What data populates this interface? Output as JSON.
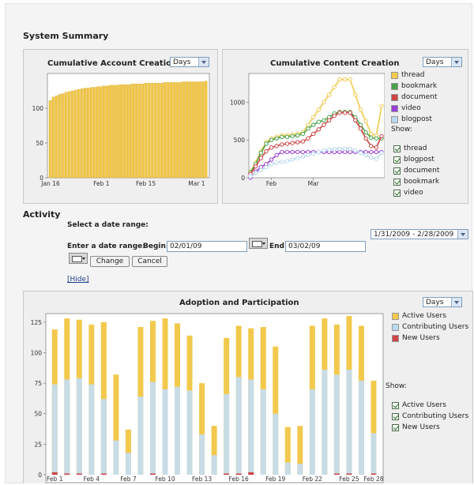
{
  "summary": {
    "title": "System Summary",
    "account_chart": {
      "title": "Cumulative Account Creation",
      "period_select": "Days"
    },
    "content_chart": {
      "title": "Cumulative Content Creation",
      "period_select": "Days",
      "show_label": "Show:"
    }
  },
  "activity": {
    "title": "Activity",
    "select_range_label": "Select a date range:",
    "range_dropdown": "1/31/2009 - 2/28/2009",
    "enter_range_label": "Enter a date range:",
    "begin_label": "Begin:",
    "begin_value": "02/01/09",
    "end_label": "End:",
    "end_value": "03/02/09",
    "change_button": "Change",
    "cancel_button": "Cancel",
    "hide_link": "[Hide]"
  },
  "adoption": {
    "title": "Adoption and Participation",
    "period_select": "Days",
    "show_label": "Show:"
  },
  "colors": {
    "yellow": "#f2c94c",
    "green": "#4aa24a",
    "red": "#cc4444",
    "purple": "#9b3fd8",
    "lightblue": "#b9d9f0"
  },
  "chart_data": [
    {
      "type": "bar",
      "title": "Cumulative Account Creation",
      "x_ticks": [
        "Jan 16",
        "Feb 1",
        "Feb 15",
        "Mar 1"
      ],
      "y_ticks": [
        0,
        50,
        100
      ],
      "ylim": [
        0,
        150
      ],
      "values": [
        111,
        116,
        118,
        120,
        121,
        123,
        124,
        125,
        126,
        127,
        128,
        129,
        129,
        130,
        130,
        131,
        131,
        132,
        132,
        133,
        133,
        133,
        134,
        134,
        134,
        134,
        135,
        135,
        135,
        135,
        136,
        136,
        136,
        136,
        136,
        136,
        137,
        137,
        137,
        137,
        137,
        137,
        138,
        138,
        138,
        138,
        138,
        138,
        138,
        139
      ]
    },
    {
      "type": "line",
      "title": "Cumulative Content Creation",
      "x_ticks": [
        "Feb",
        "Mar"
      ],
      "y_ticks": [
        0,
        500,
        1000
      ],
      "ylim": [
        0,
        1380
      ],
      "series": [
        {
          "name": "thread",
          "values": [
            80,
            200,
            350,
            470,
            520,
            540,
            560,
            560,
            570,
            580,
            600,
            700,
            800,
            900,
            1000,
            1100,
            1200,
            1300,
            1300,
            1300,
            1100,
            900,
            750,
            580,
            560,
            950
          ]
        },
        {
          "name": "bookmark",
          "values": [
            70,
            180,
            330,
            450,
            500,
            520,
            540,
            540,
            550,
            560,
            580,
            650,
            700,
            740,
            760,
            800,
            850,
            870,
            870,
            870,
            800,
            700,
            600,
            530,
            520,
            520
          ]
        },
        {
          "name": "document",
          "values": [
            50,
            150,
            260,
            350,
            400,
            420,
            440,
            450,
            460,
            470,
            480,
            520,
            580,
            640,
            700,
            760,
            820,
            860,
            860,
            860,
            760,
            650,
            520,
            420,
            400,
            550
          ]
        },
        {
          "name": "video",
          "values": [
            0,
            80,
            140,
            180,
            240,
            300,
            340,
            340,
            340,
            340,
            340,
            340,
            340,
            340,
            340,
            340,
            340,
            340,
            340,
            340,
            340,
            340,
            340,
            340,
            340,
            340
          ]
        },
        {
          "name": "blogpost",
          "values": [
            20,
            60,
            100,
            140,
            180,
            200,
            210,
            220,
            240,
            260,
            280,
            300,
            320,
            340,
            360,
            370,
            380,
            385,
            385,
            385,
            360,
            330,
            300,
            270,
            250,
            330
          ]
        }
      ]
    },
    {
      "type": "bar",
      "title": "Adoption and Participation",
      "x_ticks": [
        "Feb 1",
        "Feb 4",
        "Feb 7",
        "Feb 10",
        "Feb 13",
        "Feb 16",
        "Feb 19",
        "Feb 22",
        "Feb 25",
        "Feb 28"
      ],
      "y_ticks": [
        0,
        25,
        50,
        75,
        100,
        125
      ],
      "ylim": [
        0,
        132
      ],
      "series": [
        {
          "name": "Active Users",
          "values": [
            119,
            128,
            127,
            123,
            125,
            82,
            37,
            121,
            126,
            128,
            124,
            114,
            75,
            40,
            112,
            122,
            120,
            121,
            105,
            39,
            40,
            122,
            128,
            123,
            130,
            122,
            77
          ]
        },
        {
          "name": "Contributing Users",
          "values": [
            74,
            78,
            79,
            74,
            62,
            28,
            18,
            64,
            76,
            70,
            72,
            69,
            33,
            16,
            66,
            80,
            78,
            70,
            50,
            10,
            9,
            70,
            86,
            82,
            86,
            77,
            34
          ]
        },
        {
          "name": "New Users",
          "values": [
            2,
            1,
            1,
            0,
            1,
            0,
            0,
            0,
            1,
            0,
            0,
            0,
            0,
            0,
            1,
            1,
            2,
            0,
            0,
            0,
            0,
            0,
            0,
            1,
            1,
            0,
            1
          ]
        }
      ]
    }
  ]
}
